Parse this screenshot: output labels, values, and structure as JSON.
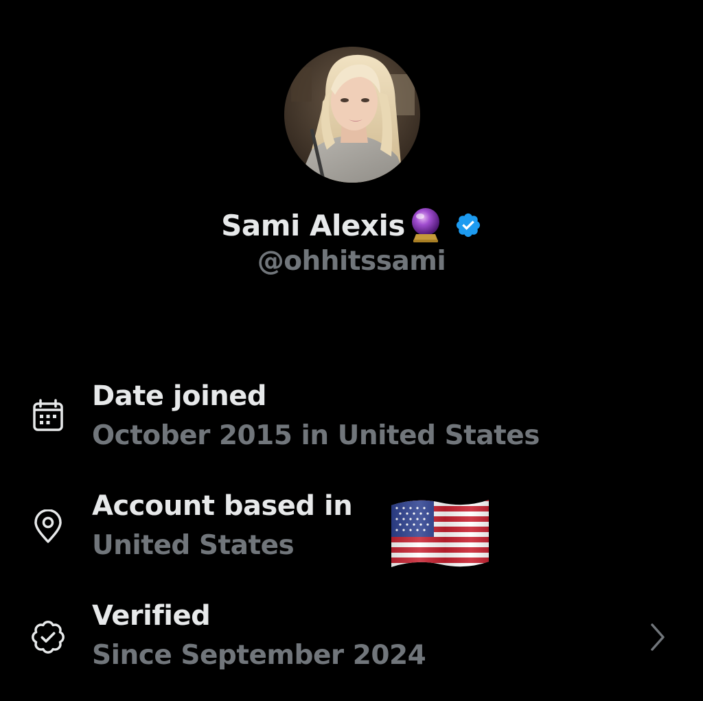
{
  "profile": {
    "display_name": "Sami Alexis",
    "handle": "@ohhitssami",
    "name_emoji": "crystal-ball",
    "badge": "verified-icon",
    "badge_color": "#1d9bf0"
  },
  "about": {
    "items": [
      {
        "icon": "calendar-icon",
        "title": "Date joined",
        "subtitle": "October 2015 in United States"
      },
      {
        "icon": "location-pin-icon",
        "title": "Account based in",
        "subtitle": "United States",
        "flag": "us-flag"
      },
      {
        "icon": "verified-badge-outline-icon",
        "title": "Verified",
        "subtitle": "Since September 2024",
        "action": "chevron-right-icon"
      }
    ]
  },
  "colors": {
    "background": "#000000",
    "primary_text": "#e7e9ea",
    "secondary_text": "#71767b",
    "accent": "#1d9bf0"
  }
}
